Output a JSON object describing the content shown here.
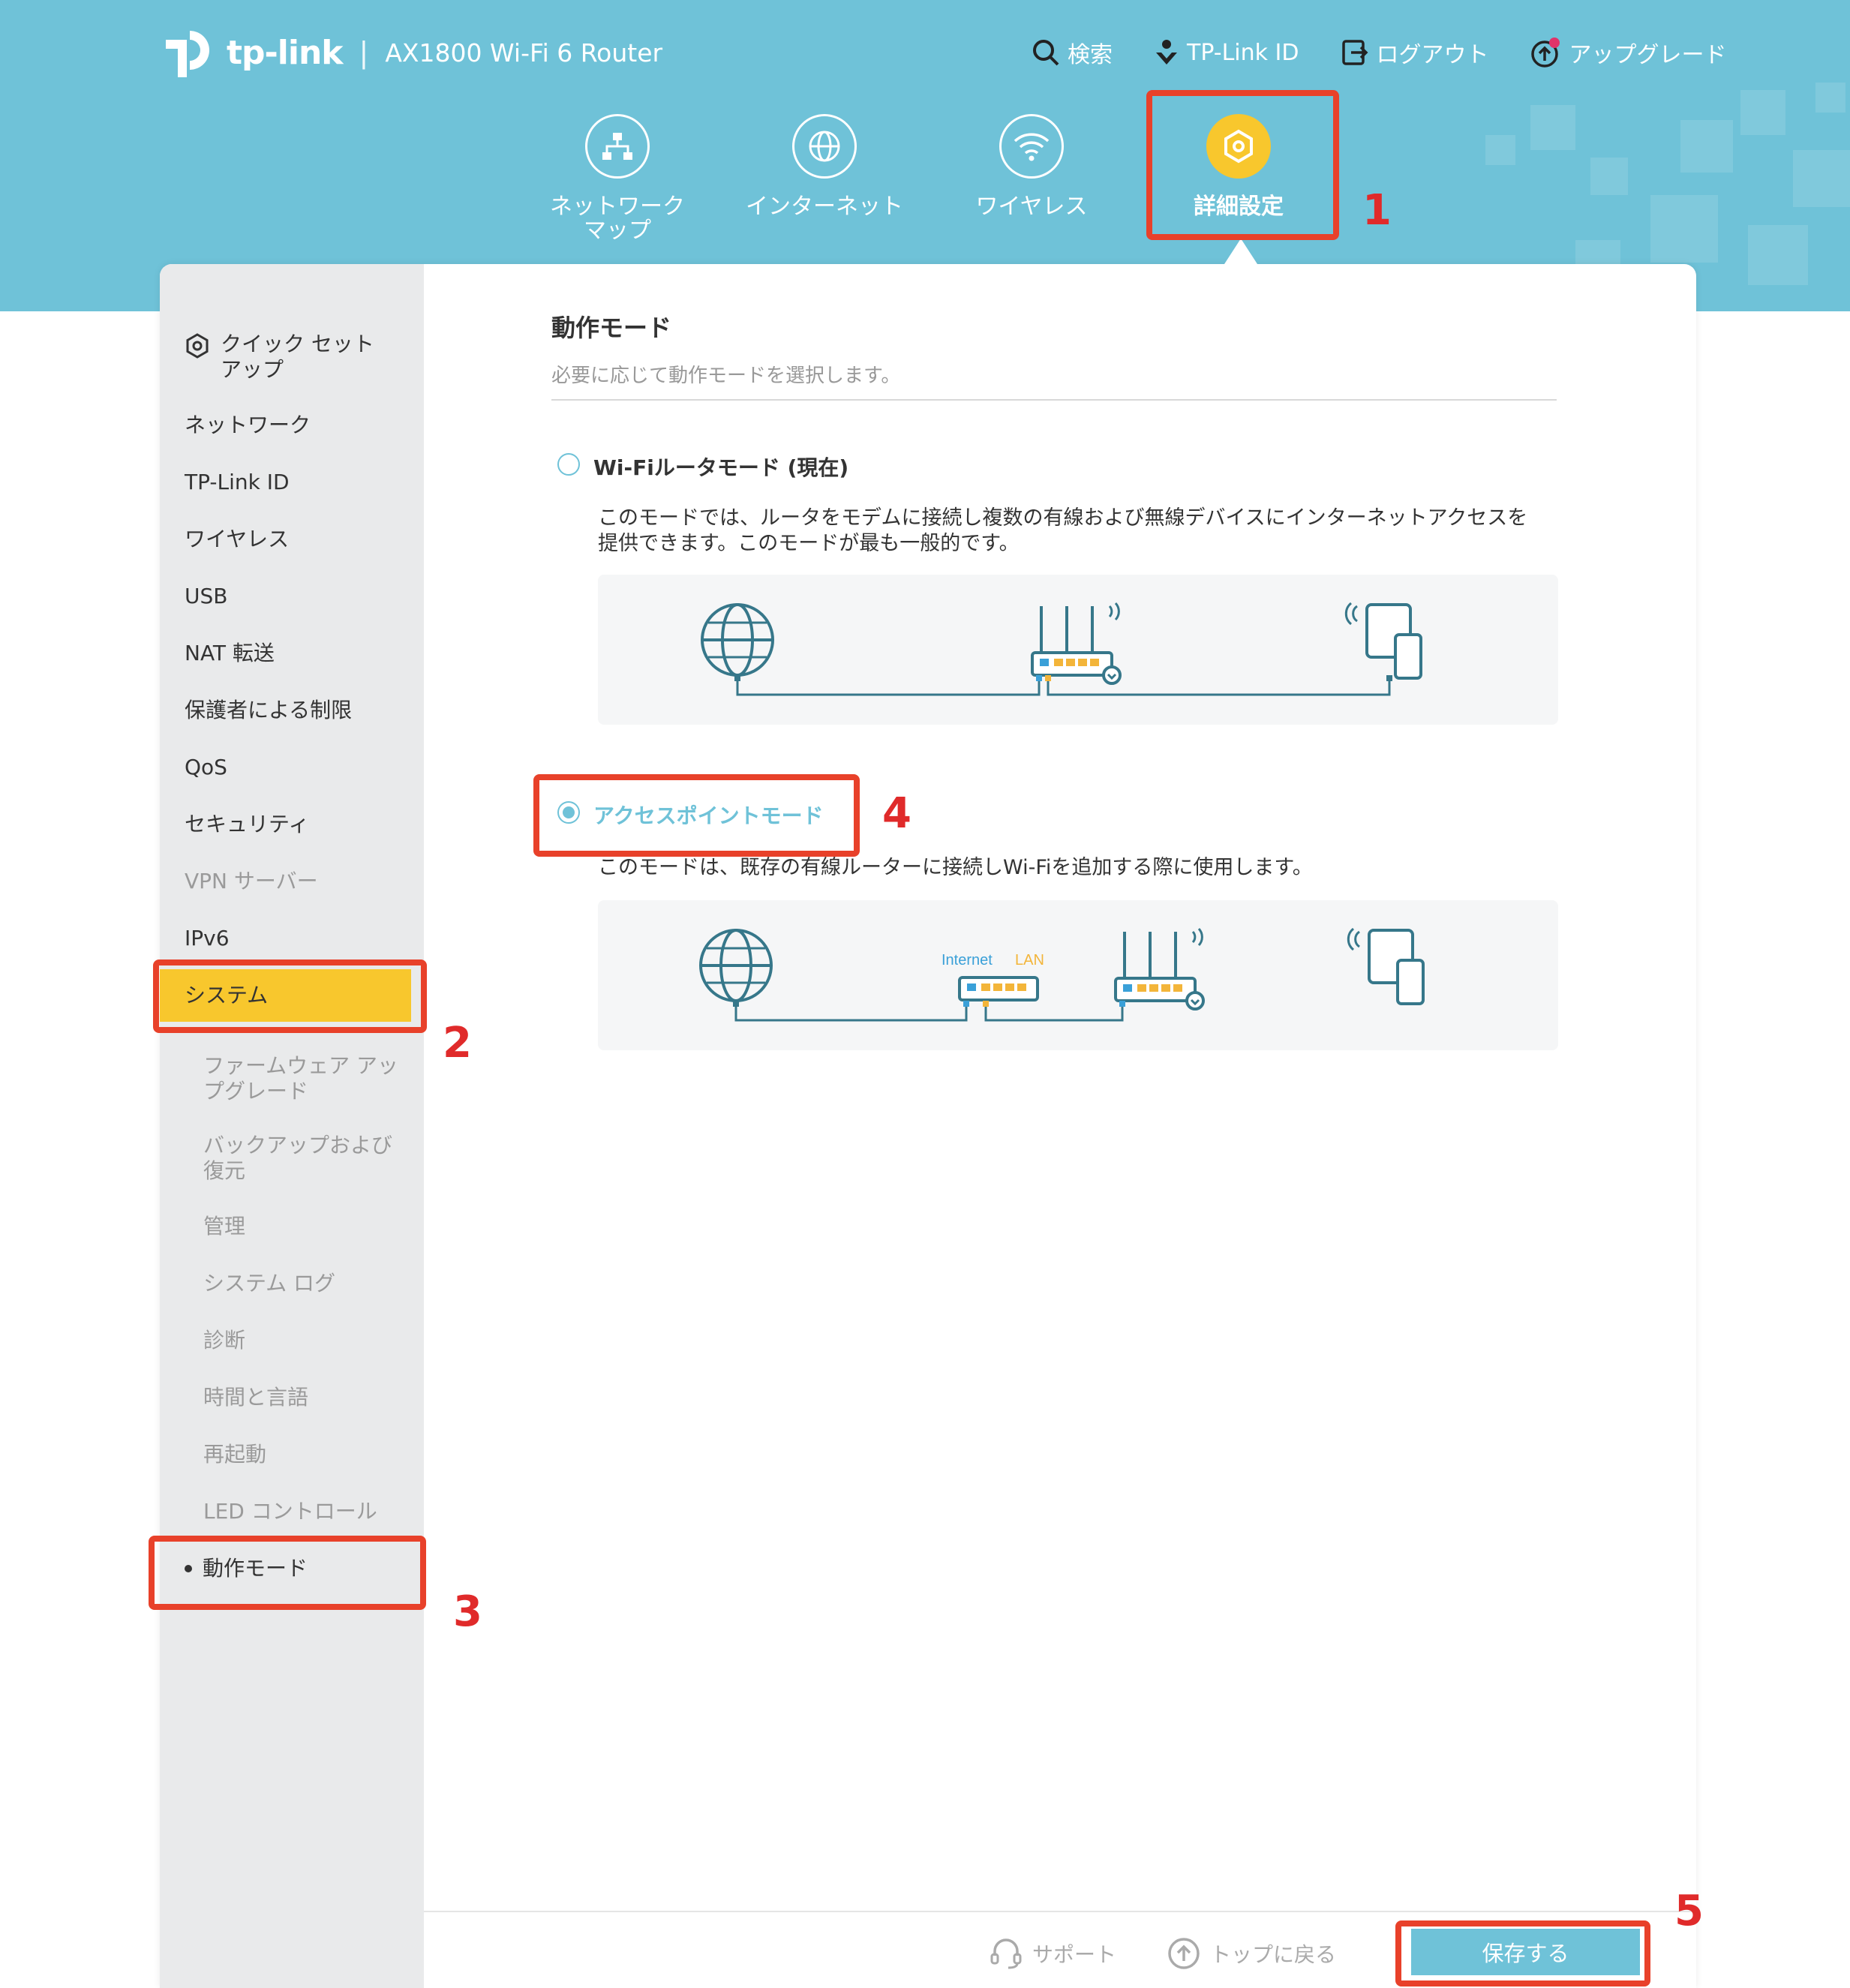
{
  "header": {
    "brand": "tp-link",
    "separator": "|",
    "model": "AX1800 Wi-Fi 6 Router",
    "top_links": [
      {
        "label": "検索",
        "icon": "search-icon"
      },
      {
        "label": "TP-Link ID",
        "icon": "tplink-id-icon"
      },
      {
        "label": "ログアウト",
        "icon": "logout-icon"
      },
      {
        "label": "アップグレード",
        "icon": "upgrade-icon"
      }
    ],
    "main_nav": [
      {
        "label": "ネットワーク\nマップ",
        "icon": "network-map-icon"
      },
      {
        "label": "インターネット",
        "icon": "internet-globe-icon"
      },
      {
        "label": "ワイヤレス",
        "icon": "wifi-icon"
      },
      {
        "label": "詳細設定",
        "icon": "gear-icon",
        "active": true
      }
    ]
  },
  "sidebar": {
    "items": [
      {
        "label": "クイック セット\nアップ",
        "icon": "gear-icon"
      },
      {
        "label": "ネットワーク"
      },
      {
        "label": "TP-Link ID"
      },
      {
        "label": "ワイヤレス"
      },
      {
        "label": "USB"
      },
      {
        "label": "NAT 転送"
      },
      {
        "label": "保護者による制限"
      },
      {
        "label": "QoS"
      },
      {
        "label": "セキュリティ"
      },
      {
        "label": "VPN サーバー"
      },
      {
        "label": "IPv6"
      },
      {
        "label": "システム",
        "selected": true
      }
    ],
    "sub_items": [
      {
        "label": "ファームウェア アッ\nプグレード"
      },
      {
        "label": "バックアップおよび\n復元"
      },
      {
        "label": "管理"
      },
      {
        "label": "システム ログ"
      },
      {
        "label": "診断"
      },
      {
        "label": "時間と言語"
      },
      {
        "label": "再起動"
      },
      {
        "label": "LED コントロール"
      },
      {
        "label": "動作モード",
        "current": true
      }
    ]
  },
  "main": {
    "title": "動作モード",
    "subtitle": "必要に応じて動作モードを選択します。",
    "options": [
      {
        "label": "Wi-Fiルータモード (現在)",
        "selected": false,
        "description": "このモードでは、ルータをモデムに接続し複数の有線および無線デバイスにインターネットアクセスを\n提供できます。このモードが最も一般的です。"
      },
      {
        "label": "アクセスポイントモード",
        "selected": true,
        "description": "このモードは、既存の有線ルーターに接続しWi-Fiを追加する際に使用します。",
        "diagram_labels": {
          "internet": "Internet",
          "lan": "LAN"
        }
      }
    ]
  },
  "footer": {
    "support": "サポート",
    "back_to_top": "トップに戻る",
    "save": "保存する"
  },
  "annotations": [
    "1",
    "2",
    "3",
    "4",
    "5"
  ],
  "colors": {
    "header_bg": "#6fc2d8",
    "accent_yellow": "#f8c72d",
    "annotation_red": "#e8412a",
    "teal": "#6fc2d8"
  }
}
